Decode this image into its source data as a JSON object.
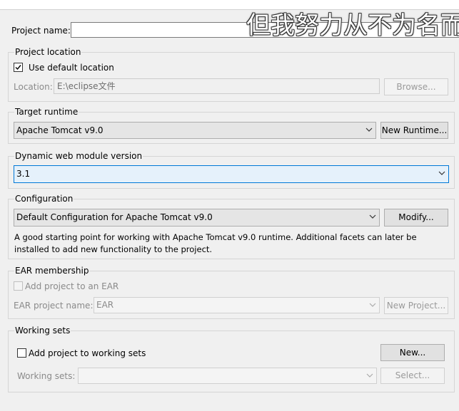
{
  "project_name": {
    "label": "Project name:",
    "value": ""
  },
  "project_location": {
    "title": "Project location",
    "use_default_label": "Use default location",
    "use_default_checked": true,
    "location_label": "Location:",
    "location_value": "E:\\eclipse文件",
    "browse_label": "Browse..."
  },
  "target_runtime": {
    "title": "Target runtime",
    "selected": "Apache Tomcat v9.0",
    "new_runtime_label": "New Runtime..."
  },
  "dynamic_web_module": {
    "title": "Dynamic web module version",
    "selected": "3.1"
  },
  "configuration": {
    "title": "Configuration",
    "selected": "Default Configuration for Apache Tomcat v9.0",
    "modify_label": "Modify...",
    "description_line1": "A good starting point for working with Apache Tomcat v9.0 runtime. Additional facets can later be",
    "description_line2": "installed to add new functionality to the project."
  },
  "ear_membership": {
    "title": "EAR membership",
    "add_label": "Add project to an EAR",
    "add_checked": false,
    "ear_name_label": "EAR project name:",
    "ear_name_value": "EAR",
    "new_project_label": "New Project..."
  },
  "working_sets": {
    "title": "Working sets",
    "add_label": "Add project to working sets",
    "add_checked": false,
    "new_label": "New...",
    "sets_label": "Working sets:",
    "sets_value": "",
    "select_label": "Select..."
  },
  "overlay_text": "但我努力从不为名而",
  "colors": {
    "accent": "#0078d7",
    "background": "#f0f0f0"
  }
}
